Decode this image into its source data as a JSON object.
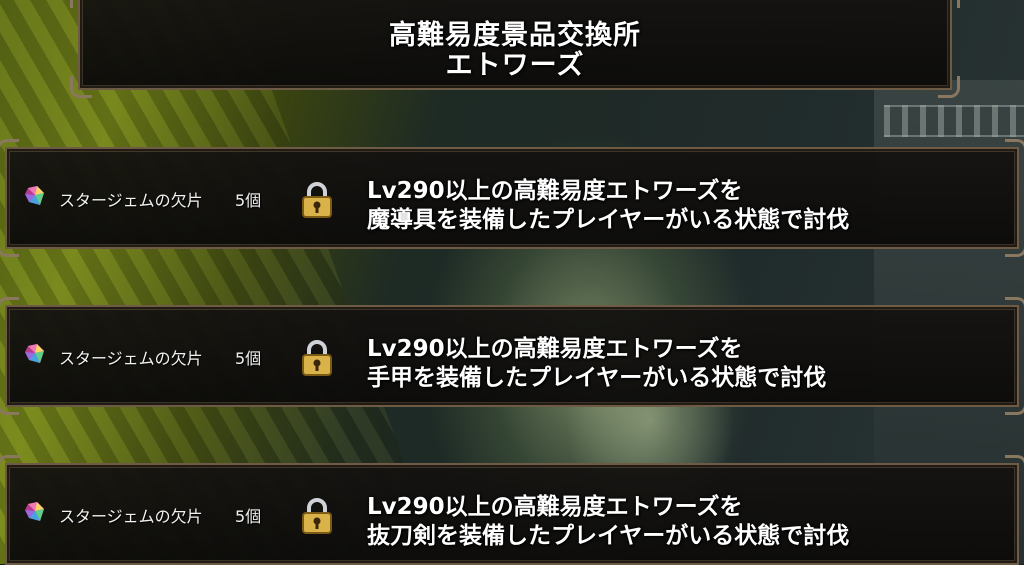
{
  "header": {
    "title_line1": "高難易度景品交換所",
    "title_line2": "エトワーズ"
  },
  "rows": [
    {
      "reward_name": "スタージェムの欠片",
      "reward_qty": "5個",
      "reward_icon": "star-gem-fragment-icon",
      "status_icon": "lock-icon",
      "condition_line1": "Lv290以上の高難易度エトワーズを",
      "condition_line2": "魔導具を装備したプレイヤーがいる状態で討伐"
    },
    {
      "reward_name": "スタージェムの欠片",
      "reward_qty": "5個",
      "reward_icon": "star-gem-fragment-icon",
      "status_icon": "lock-icon",
      "condition_line1": "Lv290以上の高難易度エトワーズを",
      "condition_line2": "手甲を装備したプレイヤーがいる状態で討伐"
    },
    {
      "reward_name": "スタージェムの欠片",
      "reward_qty": "5個",
      "reward_icon": "star-gem-fragment-icon",
      "status_icon": "lock-icon",
      "condition_line1": "Lv290以上の高難易度エトワーズを",
      "condition_line2": "抜刀剣を装備したプレイヤーがいる状態で討伐"
    }
  ],
  "colors": {
    "frame": "#6d5b46",
    "panel": "#141210",
    "text": "#ffffff",
    "lock_gold": "#d9b24a"
  }
}
